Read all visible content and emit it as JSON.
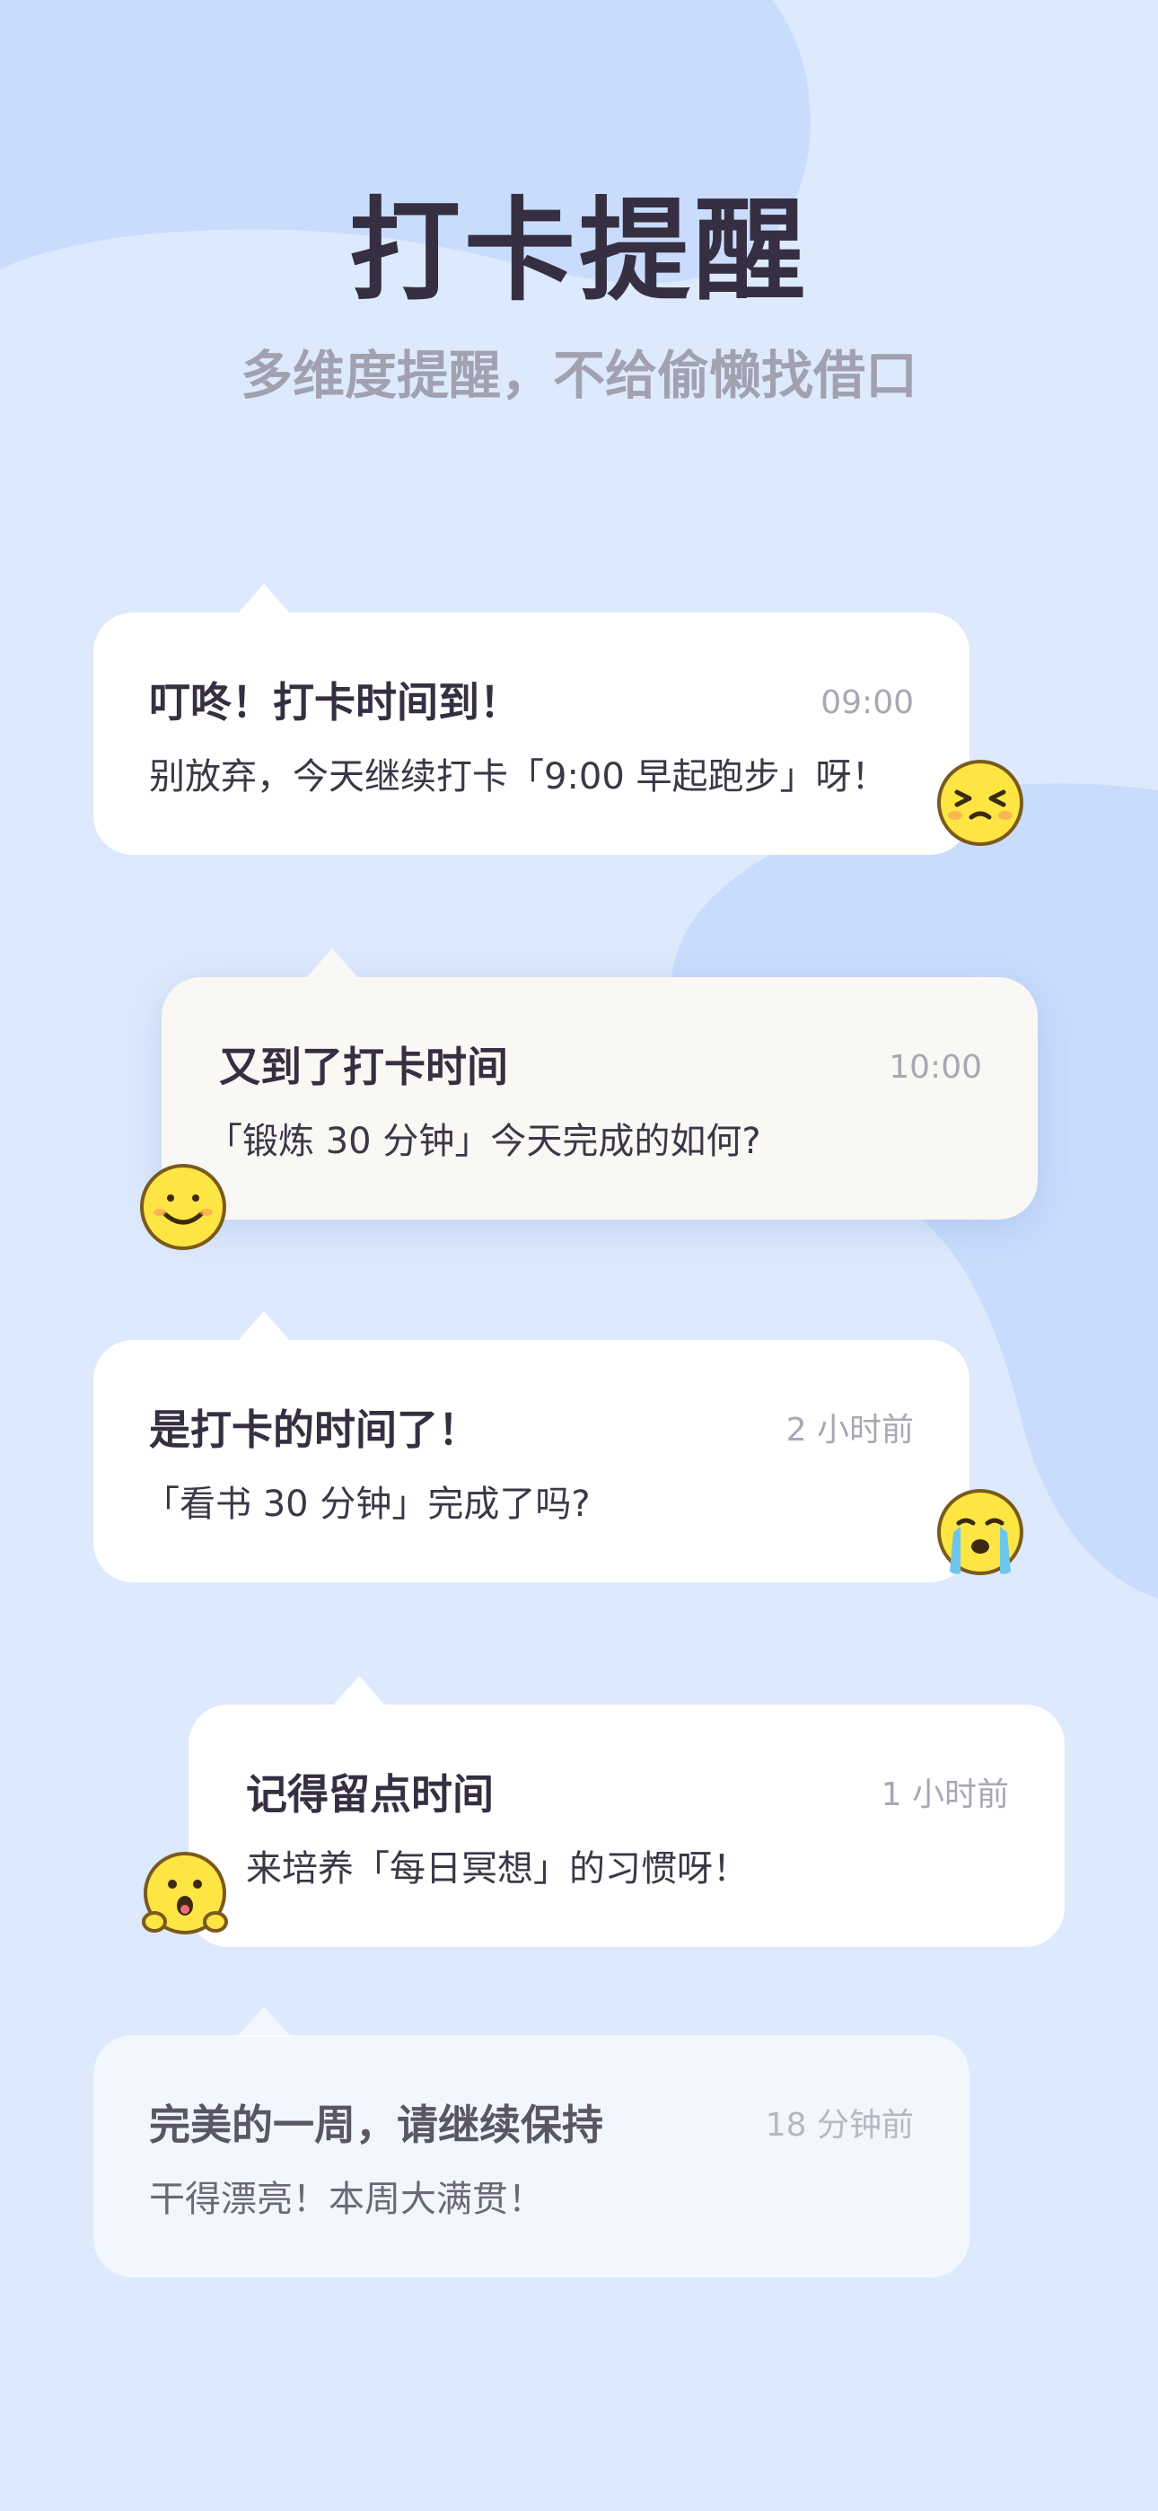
{
  "header": {
    "title": "打卡提醒",
    "subtitle": "多维度提醒，不给偷懒找借口"
  },
  "notifications": [
    {
      "title": "叮咚！打卡时间到！",
      "time": "09:00",
      "message": "别放弃，今天继续打卡「9:00 早起跑步」呀！",
      "emoji": "squinting-face-icon"
    },
    {
      "title": "又到了打卡时间",
      "time": "10:00",
      "message": "「锻炼 30 分钟」今天完成的如何?",
      "emoji": "smiling-face-icon"
    },
    {
      "title": "是打卡的时间了！",
      "time": "2 小时前",
      "message": "「看书 30 分钟」完成了吗?",
      "emoji": "crying-face-icon"
    },
    {
      "title": "记得留点时间",
      "time": "1 小时前",
      "message": "来培养「每日冥想」的习惯呀！",
      "emoji": "surprised-face-icon"
    },
    {
      "title": "完美的一周，请继续保持",
      "time": "18 分钟前",
      "message": "干得漂亮！本周大满贯！",
      "emoji": ""
    }
  ],
  "colors": {
    "background": "#dde9fd",
    "blob": "#c9dcfd",
    "title": "#352f41",
    "subtitle": "#a1a1af",
    "emoji_yellow": "#fde543",
    "emoji_outline": "#7a5a1c"
  }
}
